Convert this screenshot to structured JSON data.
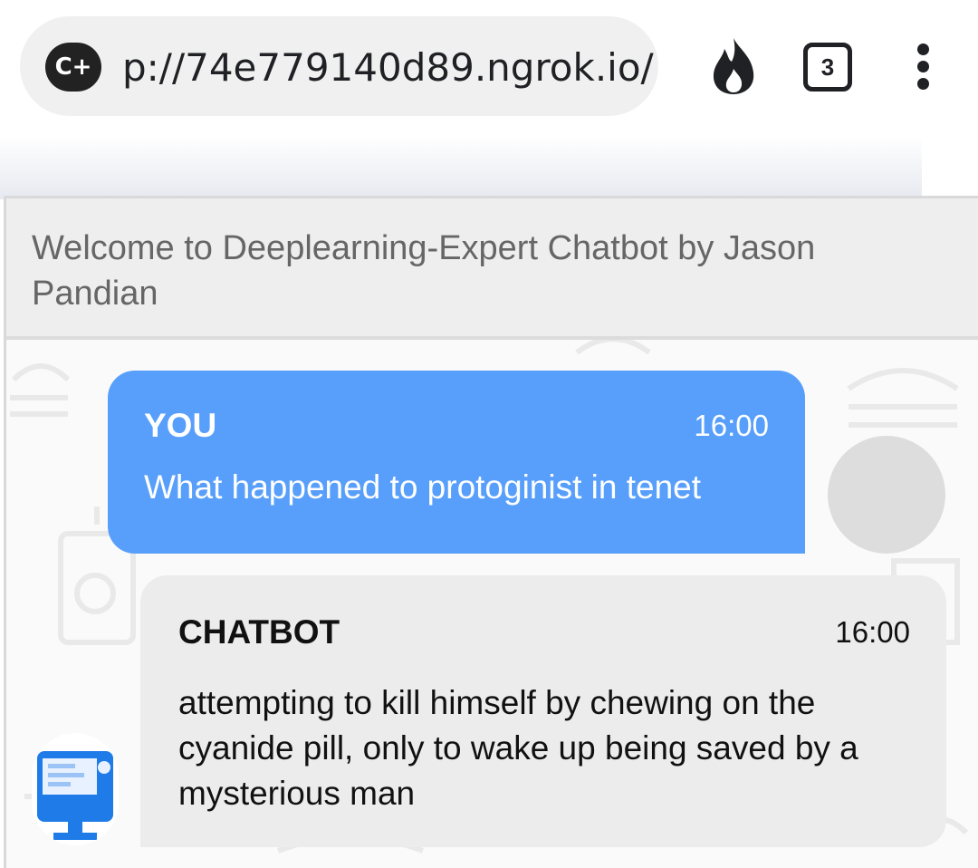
{
  "browser": {
    "url": "p://74e779140d89.ngrok.io/",
    "site_icon_text": "C+",
    "tab_count": "3"
  },
  "chat": {
    "title": "Welcome to Deeplearning-Expert Chatbot by Jason Pandian",
    "messages": [
      {
        "sender": "YOU",
        "time": "16:00",
        "text": "What happened to protoginist in tenet"
      },
      {
        "sender": "CHATBOT",
        "time": "16:00",
        "text": "attempting to kill himself by chewing on the cyanide pill, only to wake up being saved by a mysterious man"
      }
    ]
  },
  "colors": {
    "user_bubble": "#579ffb",
    "bot_bubble": "#ececec",
    "bot_avatar_blue": "#1e7be8"
  },
  "icons": [
    "site-icon",
    "fire-icon",
    "tabs-icon",
    "more-menu-icon",
    "food-doodles"
  ]
}
